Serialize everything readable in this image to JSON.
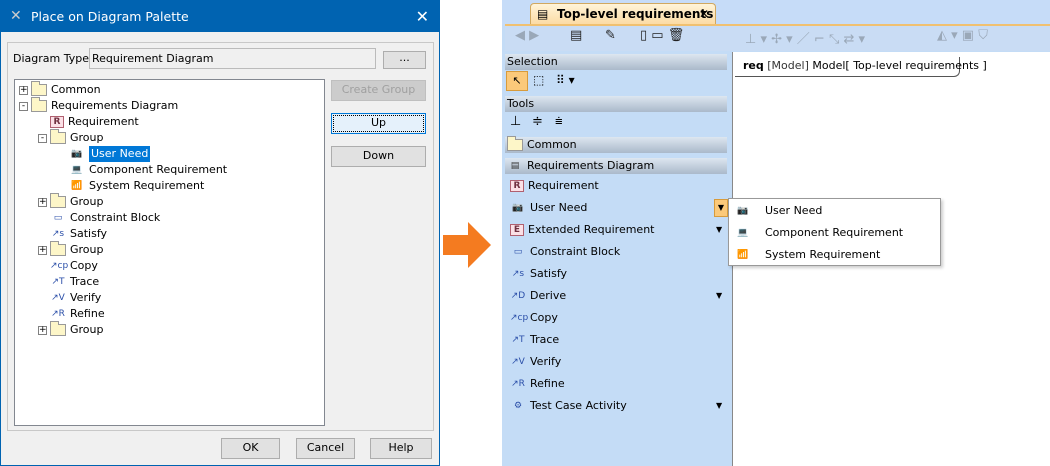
{
  "dialog": {
    "title": "Place on Diagram Palette",
    "diagram_type_label": "Diagram Type:",
    "diagram_type_value": "Requirement Diagram",
    "browse_label": "...",
    "tree": [
      {
        "label": "Common",
        "level": 0,
        "expander": "+",
        "icon": "folder"
      },
      {
        "label": "Requirements Diagram",
        "level": 0,
        "expander": "-",
        "icon": "folder"
      },
      {
        "label": "Requirement",
        "level": 1,
        "icon": "requirement"
      },
      {
        "label": "Group",
        "level": 1,
        "expander": "-",
        "icon": "folder"
      },
      {
        "label": "User Need",
        "level": 2,
        "icon": "camera",
        "selected": true
      },
      {
        "label": "Component Requirement",
        "level": 2,
        "icon": "laptop"
      },
      {
        "label": "System Requirement",
        "level": 2,
        "icon": "wifi"
      },
      {
        "label": "Group",
        "level": 1,
        "expander": "+",
        "icon": "folder"
      },
      {
        "label": "Constraint Block",
        "level": 1,
        "icon": "constraint"
      },
      {
        "label": "Satisfy",
        "level": 1,
        "icon": "satisfy"
      },
      {
        "label": "Group",
        "level": 1,
        "expander": "+",
        "icon": "folder"
      },
      {
        "label": "Copy",
        "level": 1,
        "icon": "copy"
      },
      {
        "label": "Trace",
        "level": 1,
        "icon": "trace"
      },
      {
        "label": "Verify",
        "level": 1,
        "icon": "verify"
      },
      {
        "label": "Refine",
        "level": 1,
        "icon": "refine"
      },
      {
        "label": "Group",
        "level": 1,
        "expander": "+",
        "icon": "folder"
      }
    ],
    "create_group": "Create Group",
    "up": "Up",
    "down": "Down",
    "ok": "OK",
    "cancel": "Cancel",
    "help": "Help"
  },
  "arrow_color": "#f47b20",
  "app": {
    "tab_title": "Top-level requirements",
    "diagram_header": {
      "kind": "req",
      "owner_type": "[Model]",
      "owner": "Model",
      "name": "[ Top-level requirements ]"
    },
    "palette": {
      "selection_header": "Selection",
      "tools_header": "Tools",
      "groups": [
        "Common",
        "Requirements Diagram"
      ],
      "items": [
        {
          "label": "Requirement",
          "icon": "requirement"
        },
        {
          "label": "User Need",
          "icon": "camera",
          "dropdown": true,
          "active": true
        },
        {
          "label": "Extended Requirement",
          "icon": "extended",
          "dropdown": true
        },
        {
          "label": "Constraint Block",
          "icon": "constraint"
        },
        {
          "label": "Satisfy",
          "icon": "satisfy"
        },
        {
          "label": "Derive",
          "icon": "derive",
          "dropdown": true
        },
        {
          "label": "Copy",
          "icon": "copy"
        },
        {
          "label": "Trace",
          "icon": "trace"
        },
        {
          "label": "Verify",
          "icon": "verify"
        },
        {
          "label": "Refine",
          "icon": "refine"
        },
        {
          "label": "Test Case Activity",
          "icon": "activity",
          "dropdown": true
        }
      ]
    },
    "popup": [
      "User Need",
      "Component Requirement",
      "System Requirement"
    ]
  }
}
